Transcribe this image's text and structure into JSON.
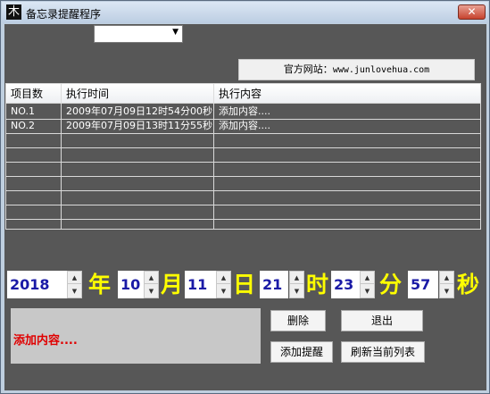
{
  "window": {
    "title": "备忘录提醒程序",
    "icon_glyph": "木",
    "close_glyph": "✕"
  },
  "combo": {
    "value": "",
    "arrow": "▼"
  },
  "website": {
    "label": "官方网站：",
    "url": "www.junlovehua.com"
  },
  "table": {
    "columns": [
      "项目数",
      "执行时间",
      "执行内容"
    ],
    "rows": [
      [
        "NO.1",
        "2009年07月09日12时54分00秒",
        "添加内容...."
      ],
      [
        "NO.2",
        "2009年07月09日13时11分55秒",
        "添加内容...."
      ]
    ]
  },
  "datetime": {
    "year": "2018",
    "month": "10",
    "day": "11",
    "hour": "21",
    "minute": "23",
    "second": "57",
    "units": {
      "year": "年",
      "month": "月",
      "day": "日",
      "hour": "时",
      "minute": "分",
      "second": "秒"
    }
  },
  "memo_text": "添加内容....",
  "buttons": {
    "delete": "删除",
    "exit": "退出",
    "add_reminder": "添加提醒",
    "refresh": "刷新当前列表"
  },
  "colors": {
    "client_bg": "#575757",
    "unit_text": "#ffff00",
    "number_text": "#1a1aa6",
    "memo_text": "#e00000"
  }
}
